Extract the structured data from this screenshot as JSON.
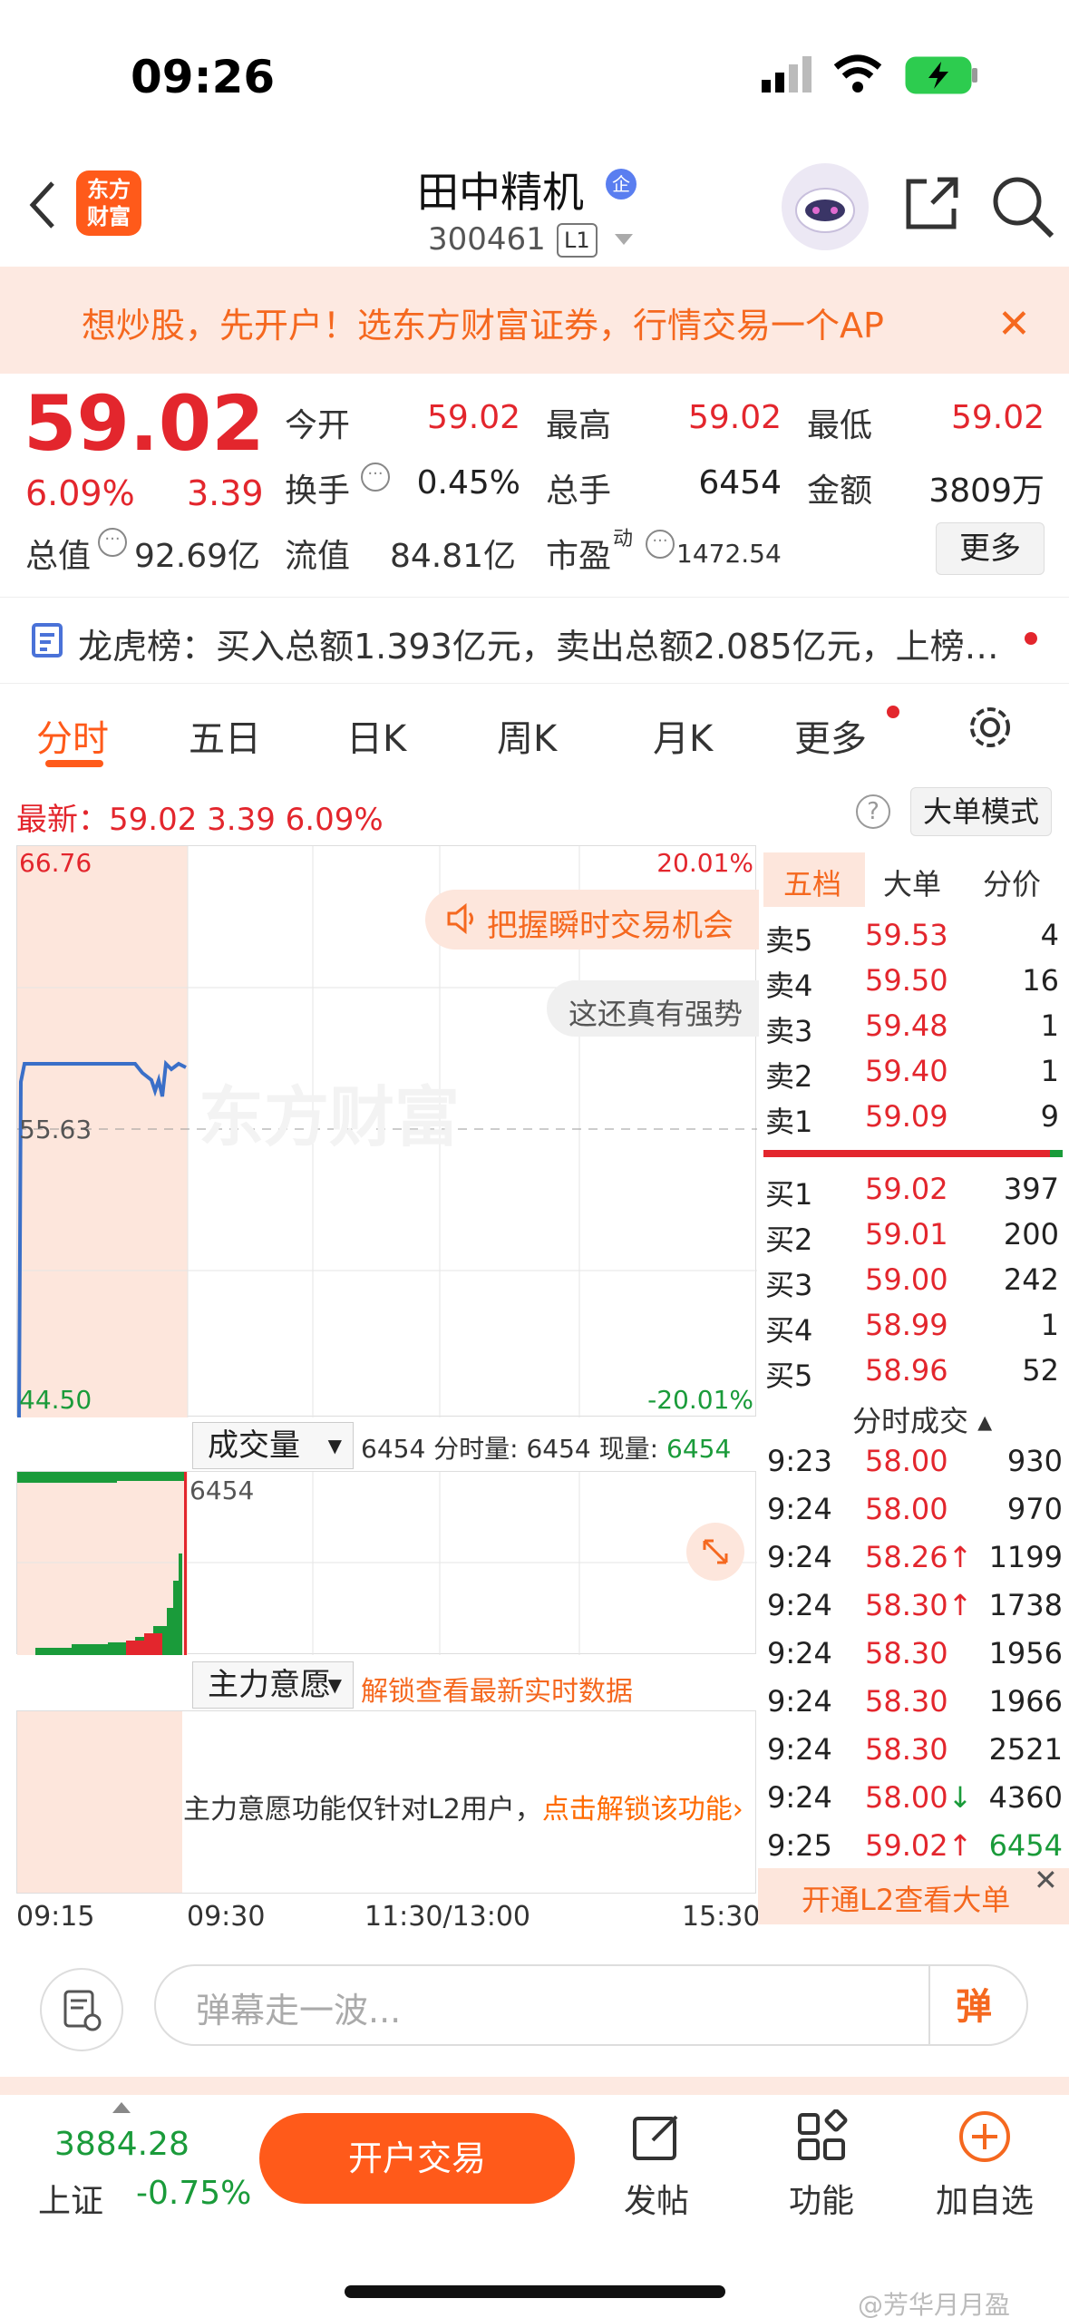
{
  "status": {
    "time": "09:26"
  },
  "header": {
    "logo_text": "东方\n财富",
    "name": "田中精机",
    "badge": "企",
    "code": "300461",
    "level": "L1"
  },
  "promo": {
    "text": "想炒股，先开户！选东方财富证券，行情交易一个AP",
    "close": "✕"
  },
  "quote": {
    "price": "59.02",
    "pct": "6.09%",
    "chg": "3.39",
    "open_label": "今开",
    "open": "59.02",
    "high_label": "最高",
    "high": "59.02",
    "low_label": "最低",
    "low": "59.02",
    "turnover_label": "换手",
    "turnover": "0.45%",
    "volume_label": "总手",
    "volume": "6454",
    "amount_label": "金额",
    "amount": "3809万",
    "mktcap_label": "总值",
    "mktcap": "92.69亿",
    "float_label": "流值",
    "float": "84.81亿",
    "pe_label": "市盈",
    "pe_sup": "动",
    "pe": "1472.54",
    "more": "更多"
  },
  "lhb": {
    "text": "龙虎榜：买入总额1.393亿元，卖出总额2.085亿元，上榜…"
  },
  "tabs": [
    "分时",
    "五日",
    "日K",
    "周K",
    "月K",
    "更多"
  ],
  "latest": {
    "text": "最新：59.02  3.39  6.09%",
    "bigmode": "大单模式",
    "help": "?"
  },
  "chart": {
    "ymax": "66.76",
    "ymid": "55.63",
    "ymin": "44.50",
    "pmax": "20.01%",
    "pmin": "-20.01%",
    "bubble1": "把握瞬时交易机会",
    "bubble2": "这还真有强势",
    "watermark": "东方财富"
  },
  "volume": {
    "dd": "成交量",
    "info_prefix": "6454 分时量: 6454 现量: ",
    "info_now": "6454",
    "peak": "6454"
  },
  "main": {
    "dd": "主力意愿",
    "unlock": "解锁查看最新实时数据",
    "msg": "主力意愿功能仅针对L2用户，",
    "msg_link": "点击解锁该功能›"
  },
  "time_labels": [
    "09:15",
    "09:30",
    "11:30/13:00",
    "15:30"
  ],
  "orderbook": {
    "tabs": [
      "五档",
      "大单",
      "分价"
    ],
    "asks": [
      [
        "卖5",
        "59.53",
        "4"
      ],
      [
        "卖4",
        "59.50",
        "16"
      ],
      [
        "卖3",
        "59.48",
        "1"
      ],
      [
        "卖2",
        "59.40",
        "1"
      ],
      [
        "卖1",
        "59.09",
        "9"
      ]
    ],
    "bids": [
      [
        "买1",
        "59.02",
        "397"
      ],
      [
        "买2",
        "59.01",
        "200"
      ],
      [
        "买3",
        "59.00",
        "242"
      ],
      [
        "买4",
        "58.99",
        "1"
      ],
      [
        "买5",
        "58.96",
        "52"
      ]
    ],
    "ticks_title": "分时成交 ▴",
    "ticks": [
      [
        "9:23",
        "58.00",
        "930",
        ""
      ],
      [
        "9:24",
        "58.00",
        "970",
        ""
      ],
      [
        "9:24",
        "58.26↑",
        "1199",
        ""
      ],
      [
        "9:24",
        "58.30↑",
        "1738",
        ""
      ],
      [
        "9:24",
        "58.30",
        "1956",
        ""
      ],
      [
        "9:24",
        "58.30",
        "1966",
        ""
      ],
      [
        "9:24",
        "58.30",
        "2521",
        ""
      ],
      [
        "9:24",
        "58.00↓",
        "4360",
        ""
      ],
      [
        "9:25",
        "59.02↑",
        "6454",
        "g"
      ]
    ],
    "l2": "开通L2查看大单"
  },
  "comment": {
    "placeholder": "弹幕走一波...",
    "danmu": "弹"
  },
  "bottom": {
    "idx_val": "3884.28",
    "idx_name": "上证",
    "idx_chg": "-0.75%",
    "trade": "开户交易",
    "post": "发帖",
    "func": "功能",
    "watch": "加自选"
  },
  "watermark": "@芳华月月盈"
}
